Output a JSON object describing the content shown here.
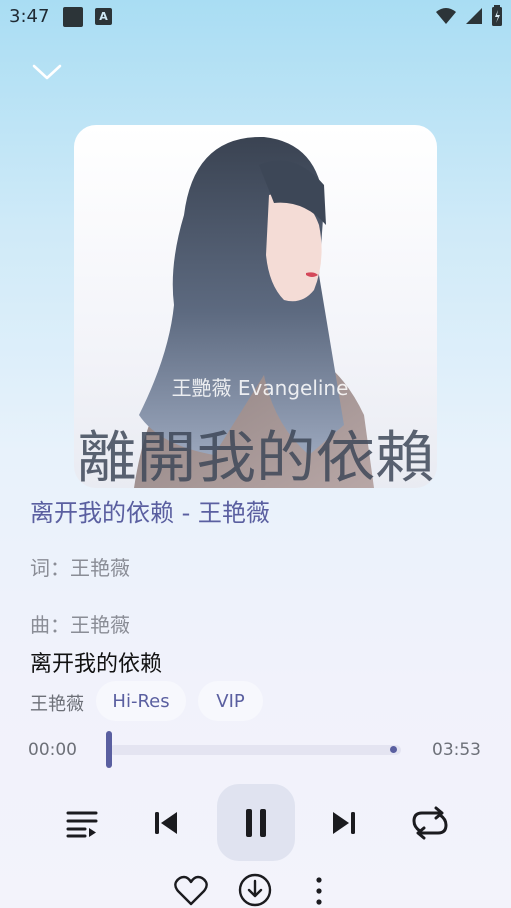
{
  "status_bar": {
    "time": "3:47"
  },
  "cover": {
    "artist_overlay": "王艷薇 Evangeline",
    "title_overlay": "離開我的依賴"
  },
  "song": {
    "title": "离开我的依赖 - 王艳薇",
    "lyrics": [
      "词：王艳薇",
      "曲：王艳薇"
    ],
    "current_lyric": "离开我的依赖",
    "artist": "王艳薇"
  },
  "tags": {
    "hires": "Hi-Res",
    "vip": "VIP"
  },
  "playback": {
    "current_time": "00:00",
    "total_time": "03:53",
    "progress": 0,
    "state": "playing"
  },
  "icons": {
    "collapse": "chevron-down-icon",
    "playlist": "playlist-icon",
    "previous": "skip-previous-icon",
    "pause": "pause-icon",
    "next": "skip-next-icon",
    "repeat": "repeat-icon",
    "like": "heart-icon",
    "download": "download-icon",
    "more": "more-vertical-icon"
  },
  "colors": {
    "accent": "#5a5fa0"
  }
}
